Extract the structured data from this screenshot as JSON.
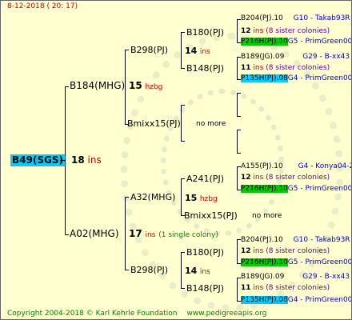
{
  "header": {
    "date": "8-12-2018 ( 20: 17)"
  },
  "footer": {
    "copyright": "Copyright 2004-2018 © Karl Kehrle Foundation",
    "site": "www.pedigreeapis.org"
  },
  "colors": {
    "background": "#ffffd0",
    "highlight_cyan": "#00ccff",
    "highlight_green": "#00cc00",
    "red": "#cc0000",
    "blue": "#0000cc",
    "green": "#008000"
  },
  "root": {
    "name": "B49(SGS)",
    "gen_num": "18",
    "gen_unit": "ins"
  },
  "b184": {
    "name": "B184(MHG)",
    "gen_num": "15",
    "gen_unit": "hzbg"
  },
  "a02": {
    "name": "A02(MHG)",
    "gen_num": "17",
    "gen_unit": "ins",
    "note": "(1 single colony)"
  },
  "b298a": {
    "name": "B298(PJ)",
    "gen_num": "14",
    "gen_unit": "ins"
  },
  "bmixx15a": {
    "name": "Bmixx15(PJ)",
    "note": "no more"
  },
  "a32": {
    "name": "A32(MHG)",
    "gen_num": "15",
    "gen_unit": "hzbg"
  },
  "b298b": {
    "name": "B298(PJ)",
    "gen_num": "14",
    "gen_unit": "ins"
  },
  "b180a": {
    "name": "B180(PJ)",
    "gen_num": "12",
    "gen_unit": "ins",
    "sisters": "(8 sister colonies)"
  },
  "b148a": {
    "name": "B148(PJ)",
    "gen_num": "11",
    "gen_unit": "ins",
    "sisters": "(8 sister colonies)"
  },
  "a241": {
    "name": "A241(PJ)",
    "gen_num": "12",
    "gen_unit": "ins",
    "sisters": "(8 sister colonies)"
  },
  "bmixx15b": {
    "name": "Bmixx15(PJ)",
    "note": "no more"
  },
  "b180b": {
    "name": "B180(PJ)",
    "gen_num": "12",
    "gen_unit": "ins",
    "sisters": "(8 sister colonies)"
  },
  "b148b": {
    "name": "B148(PJ)",
    "gen_num": "11",
    "gen_unit": "ins",
    "sisters": "(8 sister colonies)"
  },
  "g1": {
    "name": "B204(PJ).10",
    "code": "G10 - Takab93R"
  },
  "g2": {
    "name": "P216H(PJ).10",
    "code": "G5 - PrimGreen00"
  },
  "g3": {
    "name": "B189(JG).09",
    "code": "G29 - B-xx43"
  },
  "g4": {
    "name": "P135H(PJ).08",
    "code": "G4 - PrimGreen00"
  },
  "g5": {
    "name": "A155(PJ).10",
    "code": "G4 - Konya04-2"
  },
  "g6": {
    "name": "P216H(PJ).10",
    "code": "G5 - PrimGreen00"
  },
  "g7": {
    "name": "B204(PJ).10",
    "code": "G10 - Takab93R"
  },
  "g8": {
    "name": "P216H(PJ).10",
    "code": "G5 - PrimGreen00"
  },
  "g9": {
    "name": "B189(JG).09",
    "code": "G29 - B-xx43"
  },
  "g10": {
    "name": "P135H(PJ).08",
    "code": "G4 - PrimGreen00"
  }
}
